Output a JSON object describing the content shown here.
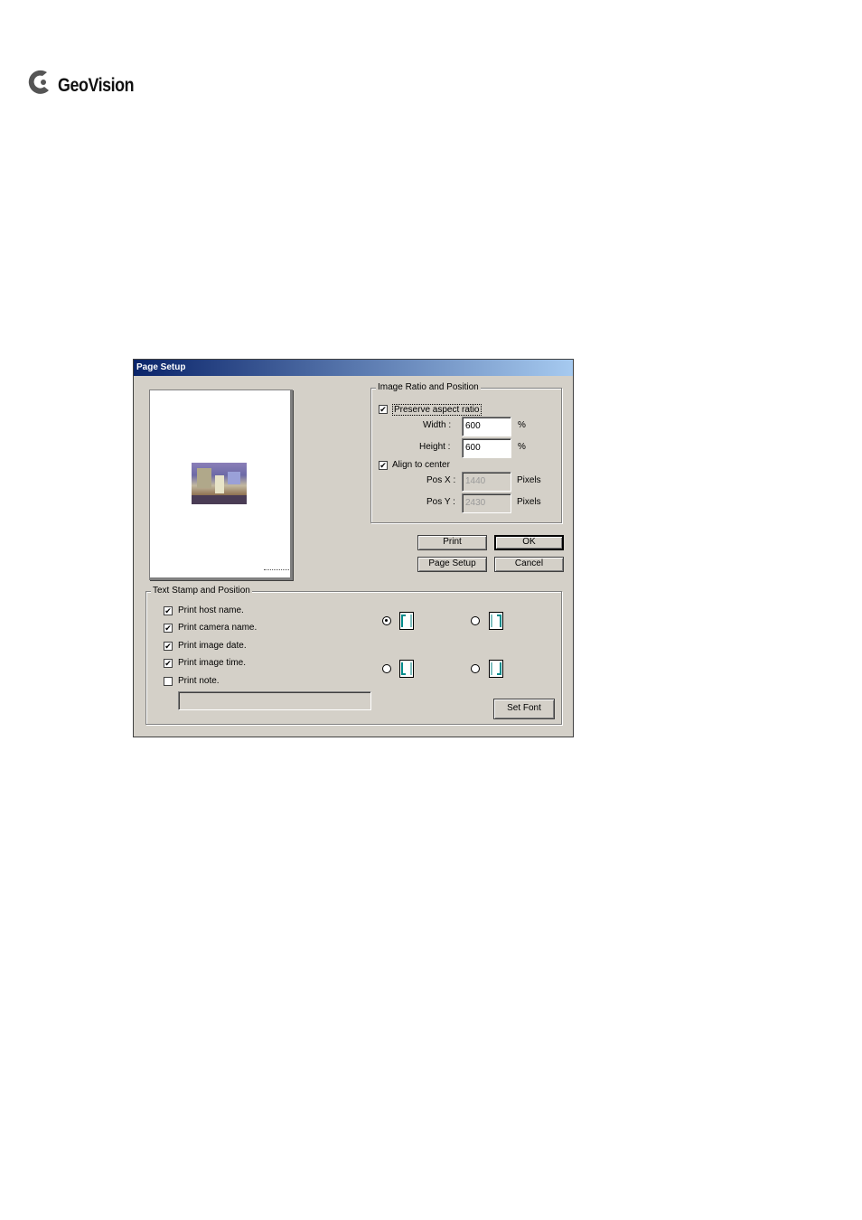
{
  "logo": {
    "text": "GeoVision"
  },
  "dialog": {
    "title": "Page Setup",
    "image_group": {
      "label": "Image Ratio and Position",
      "preserve_aspect_ratio": {
        "label": "Preserve aspect ratio",
        "checked": true
      },
      "width": {
        "label": "Width :",
        "value": "600",
        "unit": "%"
      },
      "height": {
        "label": "Height :",
        "value": "600",
        "unit": "%"
      },
      "align_to_center": {
        "label": "Align to center",
        "checked": true
      },
      "pos_x": {
        "label": "Pos X :",
        "value": "1440",
        "unit": "Pixels"
      },
      "pos_y": {
        "label": "Pos Y :",
        "value": "2430",
        "unit": "Pixels"
      }
    },
    "buttons": {
      "print": "Print",
      "ok": "OK",
      "page_setup": "Page Setup",
      "cancel": "Cancel",
      "set_font": "Set Font"
    },
    "stamp_group": {
      "label": "Text Stamp and Position",
      "options": [
        {
          "label": "Print host name.",
          "checked": true
        },
        {
          "label": "Print camera name.",
          "checked": true
        },
        {
          "label": "Print image date.",
          "checked": true
        },
        {
          "label": "Print image time.",
          "checked": true
        },
        {
          "label": "Print note.",
          "checked": false
        }
      ],
      "note_value": "",
      "positions": [
        {
          "name": "top-left",
          "selected": true
        },
        {
          "name": "top-right",
          "selected": false
        },
        {
          "name": "bottom-left",
          "selected": false
        },
        {
          "name": "bottom-right",
          "selected": false
        }
      ]
    }
  },
  "colors": {
    "titlebar_start": "#0a246a",
    "titlebar_end": "#a6caf0",
    "dialog_bg": "#d4d0c8",
    "stamp_icon": "#008b8b"
  }
}
